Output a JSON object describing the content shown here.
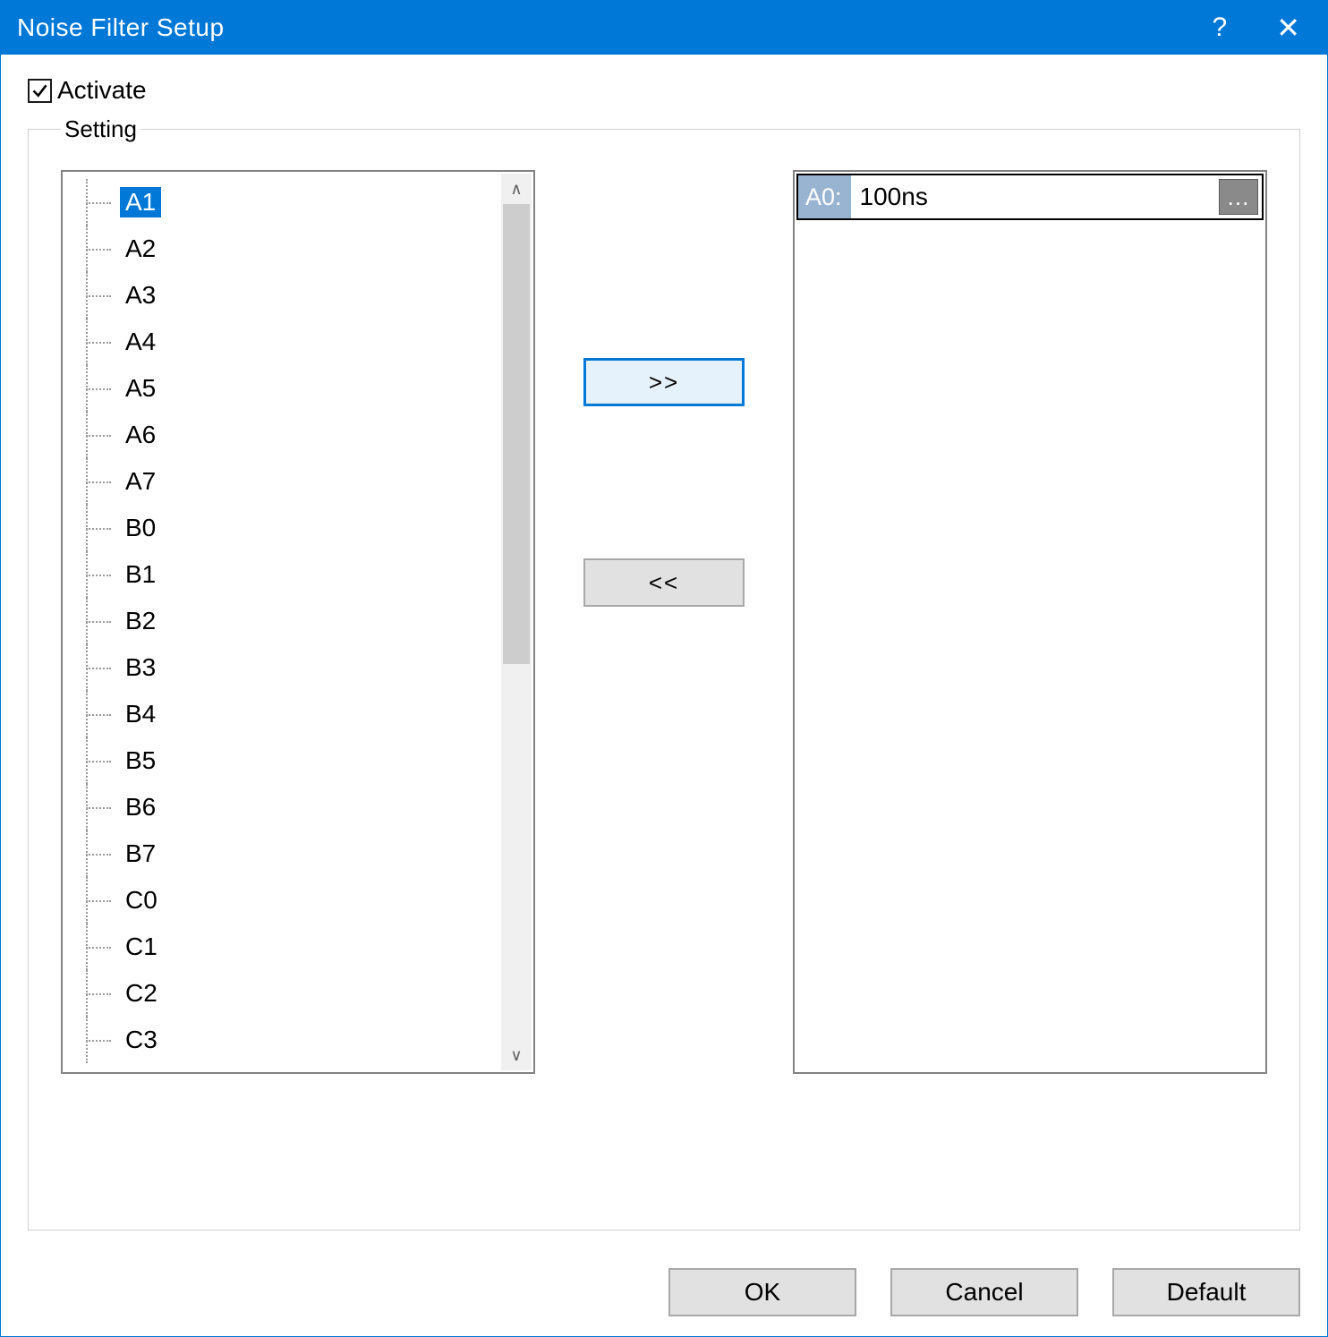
{
  "titlebar": {
    "title": "Noise Filter Setup",
    "help_glyph": "?",
    "close_glyph": "✕"
  },
  "activate": {
    "label": "Activate",
    "checked": true
  },
  "group": {
    "legend": "Setting"
  },
  "move_buttons": {
    "add_label": ">>",
    "remove_label": "<<"
  },
  "available_channels": [
    {
      "name": "A1",
      "selected": true
    },
    {
      "name": "A2",
      "selected": false
    },
    {
      "name": "A3",
      "selected": false
    },
    {
      "name": "A4",
      "selected": false
    },
    {
      "name": "A5",
      "selected": false
    },
    {
      "name": "A6",
      "selected": false
    },
    {
      "name": "A7",
      "selected": false
    },
    {
      "name": "B0",
      "selected": false
    },
    {
      "name": "B1",
      "selected": false
    },
    {
      "name": "B2",
      "selected": false
    },
    {
      "name": "B3",
      "selected": false
    },
    {
      "name": "B4",
      "selected": false
    },
    {
      "name": "B5",
      "selected": false
    },
    {
      "name": "B6",
      "selected": false
    },
    {
      "name": "B7",
      "selected": false
    },
    {
      "name": "C0",
      "selected": false
    },
    {
      "name": "C1",
      "selected": false
    },
    {
      "name": "C2",
      "selected": false
    },
    {
      "name": "C3",
      "selected": false
    }
  ],
  "configured_channels": [
    {
      "label": "A0:",
      "value": "100ns"
    }
  ],
  "scroll_arrows": {
    "up": "∧",
    "down": "∨"
  },
  "ellipsis": "...",
  "footer": {
    "ok": "OK",
    "cancel": "Cancel",
    "default": "Default"
  }
}
